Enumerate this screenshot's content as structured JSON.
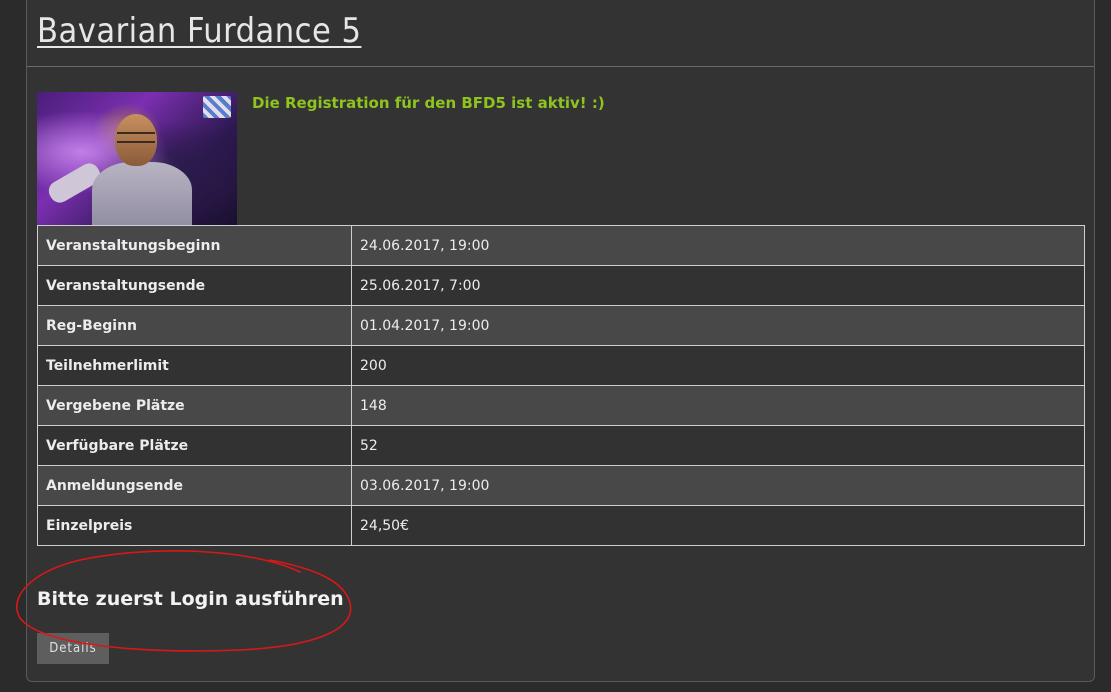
{
  "event": {
    "title": "Bavarian Furdance 5",
    "status_message": "Die Registration für den BFD5 ist aktiv! :)"
  },
  "details_table": [
    {
      "label": "Veranstaltungsbeginn",
      "value": "24.06.2017, 19:00"
    },
    {
      "label": "Veranstaltungsende",
      "value": "25.06.2017, 7:00"
    },
    {
      "label": "Reg-Beginn",
      "value": "01.04.2017, 19:00"
    },
    {
      "label": "Teilnehmerlimit",
      "value": "200"
    },
    {
      "label": "Vergebene Plätze",
      "value": "148"
    },
    {
      "label": "Verfügbare Plätze",
      "value": "52"
    },
    {
      "label": "Anmeldungsende",
      "value": "03.06.2017, 19:00"
    },
    {
      "label": "Einzelpreis",
      "value": "24,50€"
    }
  ],
  "login_prompt": "Bitte zuerst Login ausführen",
  "buttons": {
    "details_label": "Details"
  },
  "colors": {
    "background": "#2b2b2b",
    "panel": "#333333",
    "status_green": "#8fc31f",
    "annotation_red": "#d81818"
  }
}
